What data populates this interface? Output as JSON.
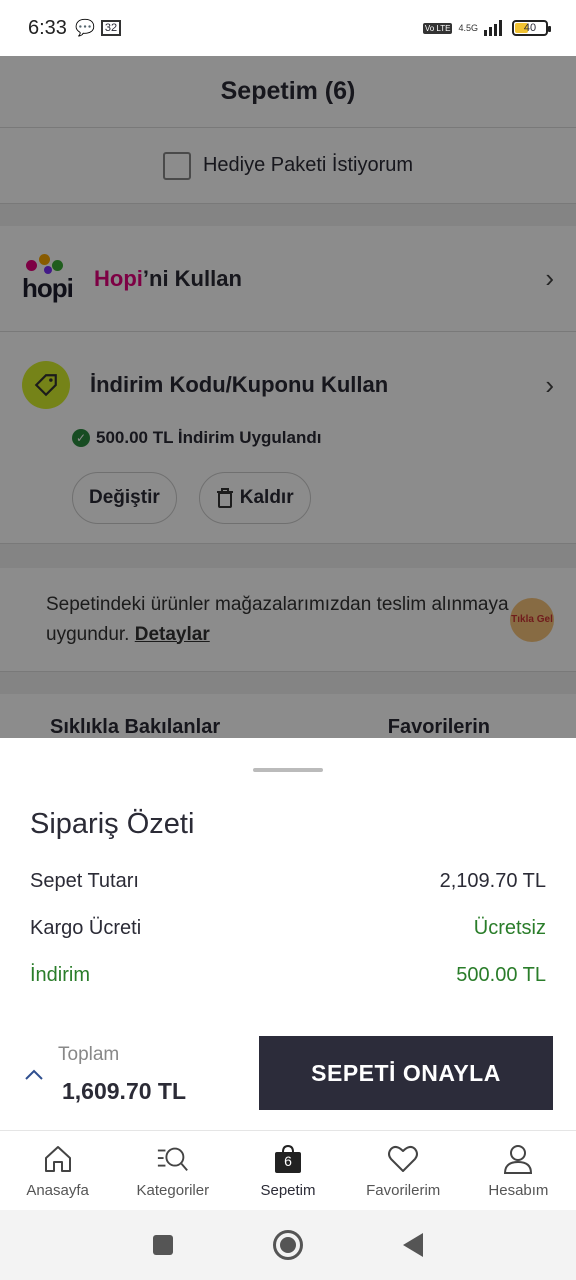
{
  "status_bar": {
    "time": "6:33",
    "notif_badge": "32",
    "network": "4.5G",
    "volte": "Vo LTE",
    "battery": "40"
  },
  "page": {
    "title": "Sepetim (6)",
    "gift_label": "Hediye Paketi İstiyorum",
    "hopi": {
      "logo_text": "hopi",
      "brand": "Hopi",
      "rest": "’ni Kullan"
    },
    "coupon": {
      "label": "İndirim Kodu/Kuponu Kullan",
      "applied": "500.00 TL İndirim Uygulandı",
      "change_btn": "Değiştir",
      "remove_btn": "Kaldır"
    },
    "store": {
      "text": "Sepetindeki ürünler mağazalarımızdan teslim alınmaya uygundur.",
      "link": "Detaylar",
      "badge": "Tıkla Gel"
    },
    "tabs": [
      "Sıklıkla Bakılanlar",
      "Favorilerin"
    ]
  },
  "summary": {
    "title": "Sipariş Özeti",
    "rows": [
      {
        "label": "Sepet Tutarı",
        "value": "2,109.70 TL"
      },
      {
        "label": "Kargo Ücreti",
        "value": "Ücretsiz"
      },
      {
        "label": "İndirim",
        "value": "500.00 TL"
      }
    ],
    "total_label": "Toplam",
    "total_value": "1,609.70 TL",
    "confirm_btn": "SEPETİ ONAYLA"
  },
  "bottom_nav": [
    {
      "label": "Anasayfa",
      "icon": "home-icon"
    },
    {
      "label": "Kategoriler",
      "icon": "categories-search-icon"
    },
    {
      "label": "Sepetim",
      "icon": "shopping-bag-icon",
      "badge": "6"
    },
    {
      "label": "Favorilerim",
      "icon": "heart-icon"
    },
    {
      "label": "Hesabım",
      "icon": "user-icon"
    }
  ],
  "colors": {
    "accent_dark": "#2c2c3a",
    "green": "#2a7d2a",
    "hopi_pink": "#e4007c",
    "coupon_icon": "#d6ee2c"
  }
}
